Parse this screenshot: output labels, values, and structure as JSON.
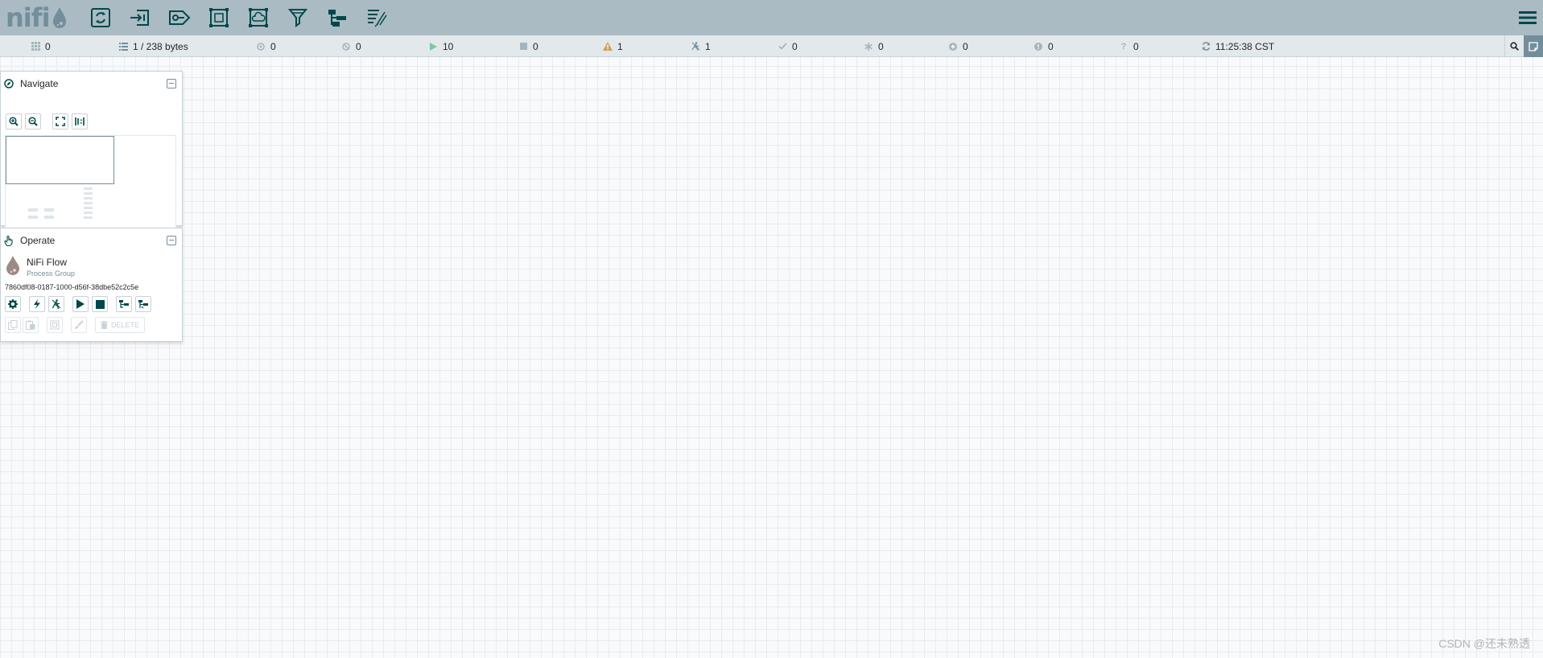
{
  "app": {
    "logo_text": "nifi"
  },
  "toolbar": {
    "items": [
      {
        "name": "processor",
        "icon": "processor-icon"
      },
      {
        "name": "input-port",
        "icon": "input-port-icon"
      },
      {
        "name": "output-port",
        "icon": "output-port-icon"
      },
      {
        "name": "process-group",
        "icon": "process-group-icon"
      },
      {
        "name": "remote-process-group",
        "icon": "remote-process-group-icon"
      },
      {
        "name": "funnel",
        "icon": "funnel-icon"
      },
      {
        "name": "template",
        "icon": "template-icon"
      },
      {
        "name": "label",
        "icon": "label-icon"
      }
    ],
    "menu_icon": "hamburger-icon"
  },
  "status": {
    "active_threads": "0",
    "queued": "1 / 238 bytes",
    "transmitting": "0",
    "not_transmitting": "0",
    "running": "10",
    "stopped": "0",
    "invalid": "1",
    "disabled": "1",
    "up_to_date": "0",
    "locally_modified": "0",
    "stale": "0",
    "locally_modified_and_stale": "0",
    "sync_failure": "0",
    "last_refreshed": "11:25:38 CST"
  },
  "navigate": {
    "title": "Navigate"
  },
  "operate": {
    "title": "Operate",
    "group_name": "NiFi Flow",
    "group_type": "Process Group",
    "group_id": "7860df08-0187-1000-d56f-38dbe52c2c5e",
    "delete_label": "DELETE"
  },
  "watermark": "CSDN @还未熟透",
  "colors": {
    "header": "#aabbc3",
    "icon": "#004849",
    "statusbar": "#e3e8eb",
    "running": "#7dc7a0",
    "warning": "#ba554a",
    "accent": "#728e9b"
  }
}
